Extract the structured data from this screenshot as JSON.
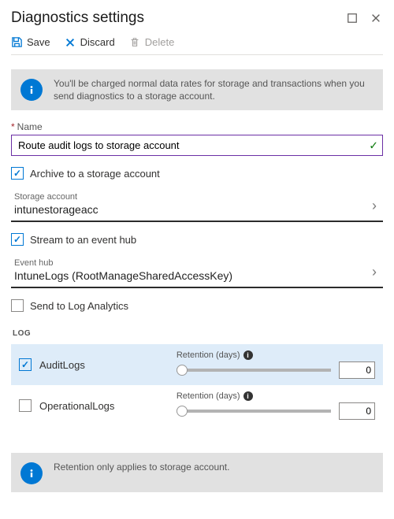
{
  "header": {
    "title": "Diagnostics settings"
  },
  "toolbar": {
    "save": "Save",
    "discard": "Discard",
    "delete": "Delete"
  },
  "info1": "You'll be charged normal data rates for storage and transactions when you send diagnostics to a storage account.",
  "name": {
    "label": "Name",
    "value": "Route audit logs to storage account"
  },
  "checks": {
    "archive": "Archive to a storage account",
    "stream": "Stream to an event hub",
    "logAnalytics": "Send to Log Analytics"
  },
  "storage": {
    "label": "Storage account",
    "value": "intunestorageacc"
  },
  "eventhub": {
    "label": "Event hub",
    "value": "IntuneLogs (RootManageSharedAccessKey)"
  },
  "logSection": "LOG",
  "retentionLabel": "Retention (days)",
  "logs": {
    "audit": {
      "label": "AuditLogs",
      "retention": "0"
    },
    "ops": {
      "label": "OperationalLogs",
      "retention": "0"
    }
  },
  "info2": "Retention only applies to storage account."
}
